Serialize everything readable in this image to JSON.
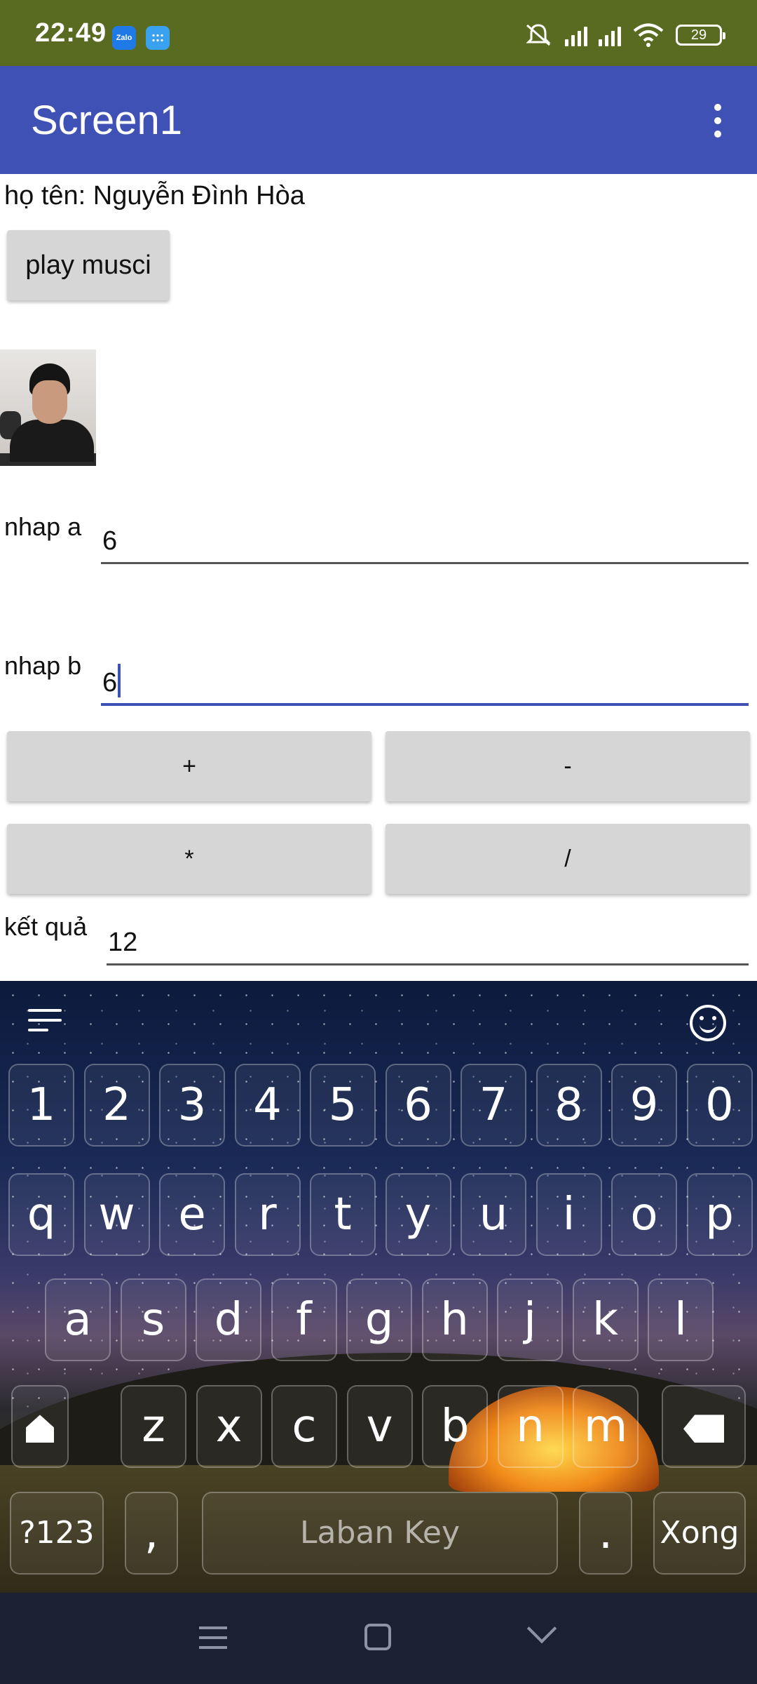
{
  "status_bar": {
    "time": "22:49",
    "zalo_label": "Zalo",
    "battery": "29",
    "icons": [
      "zalo-icon",
      "keypad-icon",
      "mute-icon",
      "signal-icon",
      "signal-icon",
      "wifi-icon",
      "battery-icon"
    ]
  },
  "app_bar": {
    "title": "Screen1",
    "menu_icon": "more-vert-icon"
  },
  "content": {
    "name_label": "họ tên: Nguyễn Đình Hòa",
    "play_button": "play musci",
    "input_a": {
      "label": "nhap a",
      "value": "6"
    },
    "input_b": {
      "label": "nhap b",
      "value": "6"
    },
    "ops": {
      "plus": "+",
      "minus": "-",
      "multiply": "*",
      "divide": "/"
    },
    "result": {
      "label": "kết quả",
      "value": "12"
    }
  },
  "keyboard": {
    "row_numbers": [
      "1",
      "2",
      "3",
      "4",
      "5",
      "6",
      "7",
      "8",
      "9",
      "0"
    ],
    "row_1": [
      "q",
      "w",
      "e",
      "r",
      "t",
      "y",
      "u",
      "i",
      "o",
      "p"
    ],
    "row_2": [
      "a",
      "s",
      "d",
      "f",
      "g",
      "h",
      "j",
      "k",
      "l"
    ],
    "row_3": [
      "z",
      "x",
      "c",
      "v",
      "b",
      "n",
      "m"
    ],
    "symbols_key": "?123",
    "comma_key": ",",
    "space_label": "Laban Key",
    "period_key": ".",
    "done_key": "Xong"
  },
  "colors": {
    "status_bar": "#596b21",
    "app_bar": "#3f51b5",
    "nav_bar": "#1b2133",
    "button": "#d6d6d6"
  }
}
